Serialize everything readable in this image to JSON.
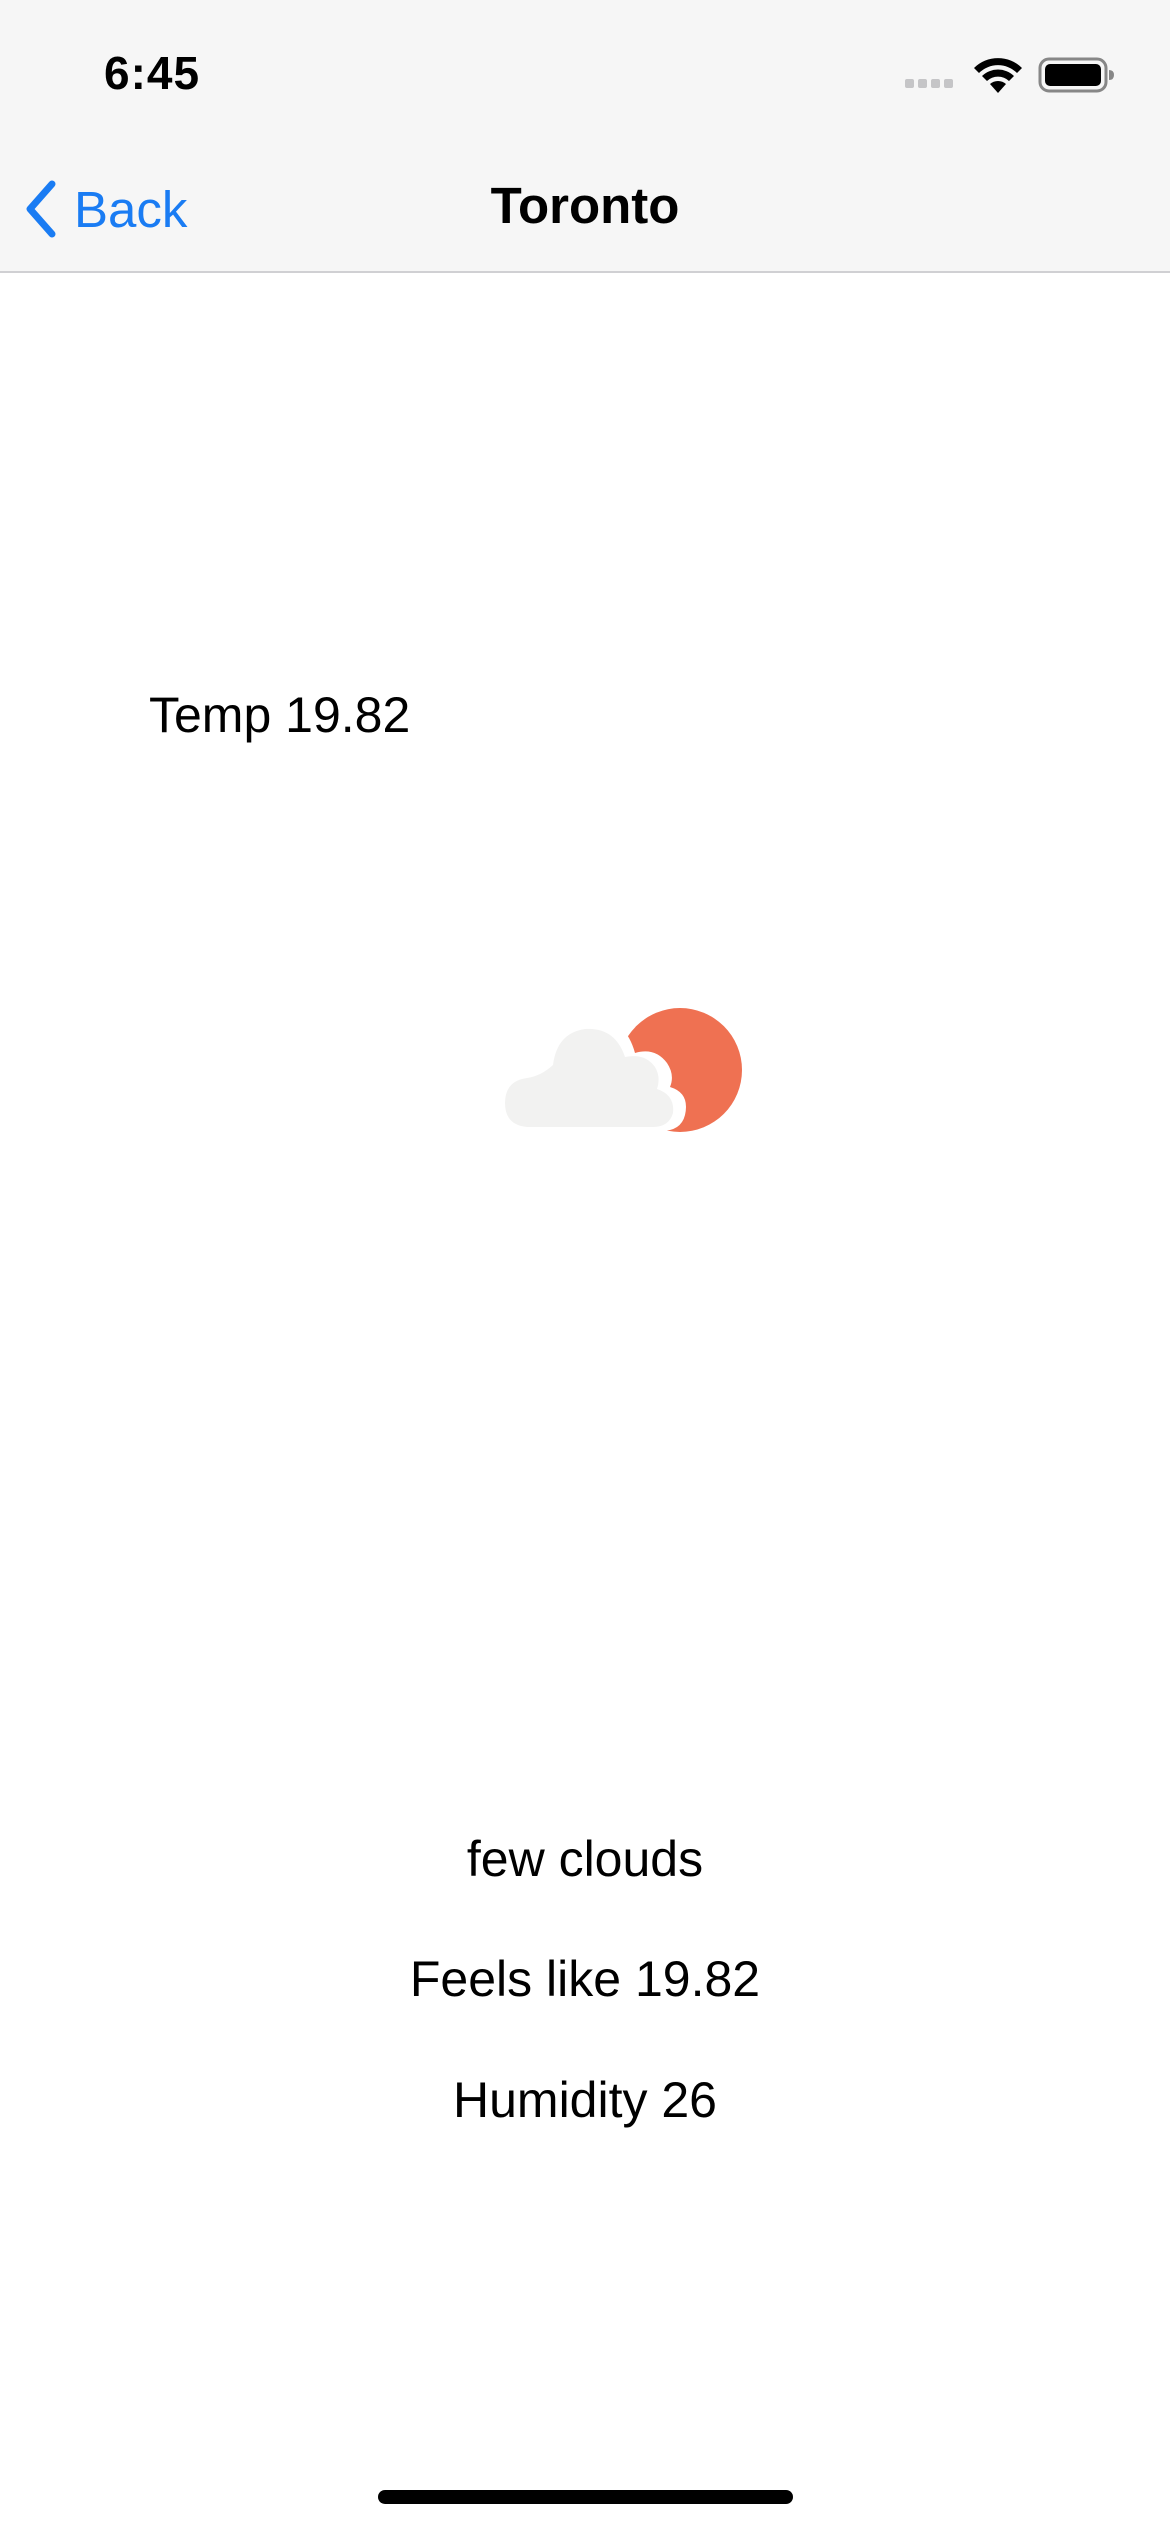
{
  "status_bar": {
    "time": "6:45",
    "icons": [
      "cellular-signal-icon",
      "wifi-icon",
      "battery-icon"
    ]
  },
  "nav": {
    "back_label": "Back",
    "back_icon": "chevron-left-icon",
    "title": "Toronto"
  },
  "weather": {
    "temp_text": "Temp 19.82",
    "icon": "few-clouds-icon",
    "description": "few clouds",
    "feels_like_text": "Feels like 19.82",
    "humidity_text": "Humidity 26"
  },
  "colors": {
    "accent": "#1a7cf3",
    "sun": "#ef7152",
    "cloud": "#f2f2f1",
    "bar_background": "#f6f6f6"
  }
}
